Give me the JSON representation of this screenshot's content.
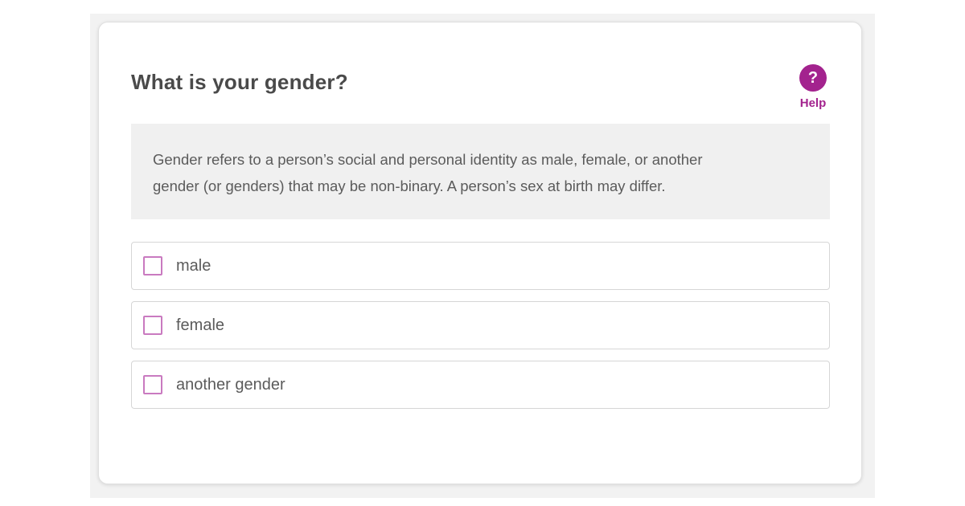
{
  "theme": {
    "accent": "#a3238e",
    "checkbox_border": "#c97ac0"
  },
  "question": {
    "title": "What is your gender?",
    "help": {
      "icon": "question-mark-icon",
      "glyph": "?",
      "label": "Help"
    },
    "definition_line1": "Gender refers to a person’s social and personal identity as male, female, or another",
    "definition_line2": "gender (or genders) that may be non-binary. A person’s sex at birth may differ."
  },
  "options": [
    {
      "label": "male",
      "checked": false
    },
    {
      "label": "female",
      "checked": false
    },
    {
      "label": "another gender",
      "checked": false
    }
  ]
}
